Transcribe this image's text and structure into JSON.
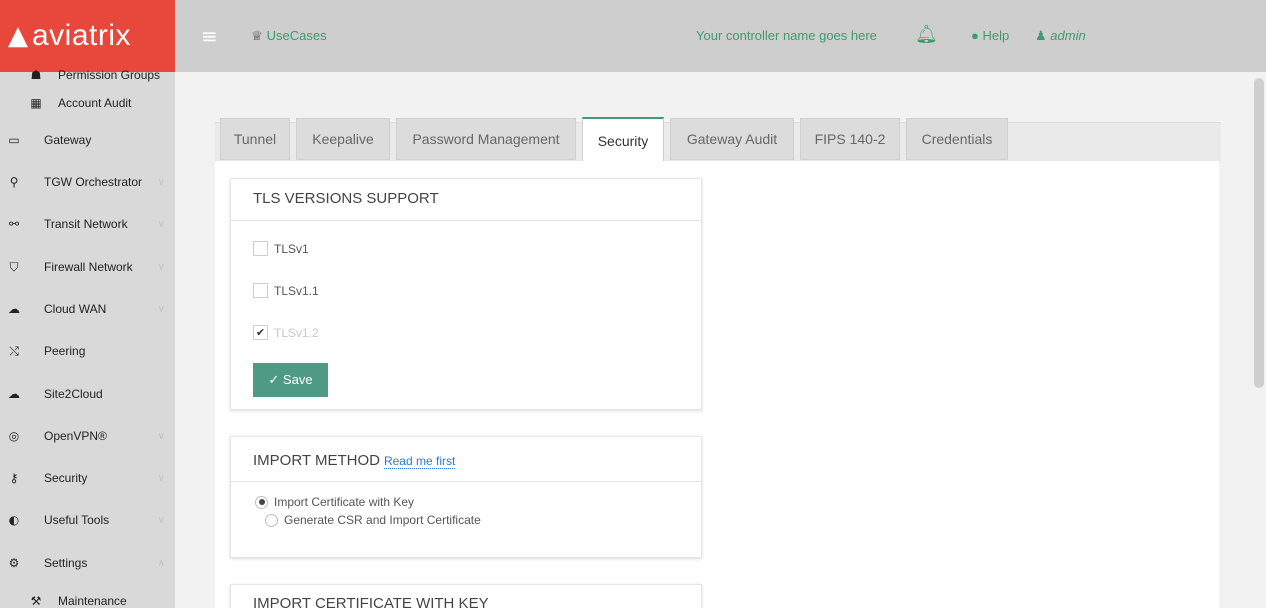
{
  "brand": {
    "logo_mark": "▲",
    "logo_text": "aviatrix",
    "color": "#e8473c",
    "accent": "#3f9b6e"
  },
  "header": {
    "usecases_icon": "lightbulb-icon",
    "usecases_label": "UseCases",
    "controller_name": "Your controller name goes here",
    "help_label": "Help",
    "user_label": "admin"
  },
  "sidebar": {
    "items": [
      {
        "label": "Permission Groups",
        "icon": "users-icon",
        "sub": true
      },
      {
        "label": "Account Audit",
        "icon": "table-icon",
        "sub": true
      },
      {
        "label": "Gateway",
        "icon": "monitor-icon"
      },
      {
        "label": "TGW Orchestrator",
        "icon": "network-icon"
      },
      {
        "label": "Transit Network",
        "icon": "sitemap-icon"
      },
      {
        "label": "Firewall Network",
        "icon": "shield-icon"
      },
      {
        "label": "Cloud WAN",
        "icon": "cloud-icon"
      },
      {
        "label": "Peering",
        "icon": "shuffle-icon"
      },
      {
        "label": "Site2Cloud",
        "icon": "cloud-upload-icon"
      },
      {
        "label": "OpenVPN®",
        "icon": "wifi-icon"
      },
      {
        "label": "Security",
        "icon": "key-icon"
      },
      {
        "label": "Useful Tools",
        "icon": "tools-icon"
      },
      {
        "label": "Settings",
        "icon": "gear-icon"
      },
      {
        "label": "Maintenance",
        "icon": "wrench-icon",
        "sub": true
      }
    ]
  },
  "tabs": [
    {
      "label": "Tunnel"
    },
    {
      "label": "Keepalive"
    },
    {
      "label": "Password Management"
    },
    {
      "label": "Security",
      "active": true
    },
    {
      "label": "Gateway Audit"
    },
    {
      "label": "FIPS 140-2"
    },
    {
      "label": "Credentials"
    }
  ],
  "tls_card": {
    "title": "TLS VERSIONS SUPPORT",
    "options": [
      {
        "label": "TLSv1",
        "checked": false,
        "disabled": false
      },
      {
        "label": "TLSv1.1",
        "checked": false,
        "disabled": false
      },
      {
        "label": "TLSv1.2",
        "checked": true,
        "disabled": true
      }
    ],
    "save_label": "✓ Save"
  },
  "import_card": {
    "title": "IMPORT METHOD",
    "link": "Read me first",
    "options": [
      {
        "label": "Import Certificate with Key",
        "selected": true
      },
      {
        "label": "Generate CSR and Import Certificate",
        "selected": false
      }
    ]
  },
  "cert_card": {
    "title": "IMPORT CERTIFICATE WITH KEY"
  }
}
